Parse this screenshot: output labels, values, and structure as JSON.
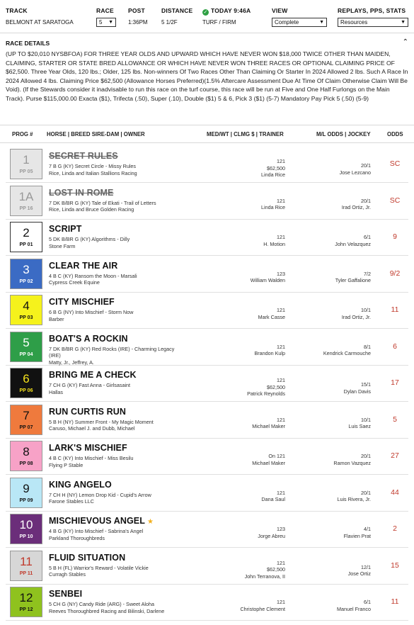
{
  "header": {
    "track_label": "TRACK",
    "track_value": "BELMONT AT SARATOGA",
    "race_label": "RACE",
    "race_value": "5",
    "post_label": "POST",
    "post_value": "1:36PM",
    "distance_label": "DISTANCE",
    "distance_value": "5 1/2F",
    "today_label": "TODAY 9:46A",
    "surface_value": "TURF / FIRM",
    "view_label": "VIEW",
    "view_value": "Complete",
    "replays_label": "REPLAYS, PPS, STATS",
    "replays_value": "Resources"
  },
  "race_details": {
    "title": "RACE DETAILS",
    "text": "(UP TO $20,010 NYSBFOA) FOR THREE YEAR OLDS AND UPWARD WHICH HAVE NEVER WON $18,000 TWICE OTHER THAN MAIDEN, CLAIMING, STARTER OR STATE BRED ALLOWANCE OR WHICH HAVE NEVER WON THREE RACES OR OPTIONAL CLAIMING PRICE OF $62,500. Three Year Olds, 120 lbs.; Older, 125 lbs. Non-winners Of Two Races Other Than Claiming Or Starter In 2024 Allowed 2 lbs. Such A Race In 2024 Allowed 4 lbs. Claiming Price $62,500 (Allowance Horses Preferred)(1.5% Aftercare Assessment Due At Time Of Claim Otherwise Claim Will Be Void). (If the Stewards consider it inadvisable to run this race on the turf course, this race will be run at Five and One Half Furlongs on the Main Track). Purse $115,000.00 Exacta ($1), Trifecta (.50), Super (.10), Double ($1) 5 & 6, Pick 3 ($1) (5-7) Mandatory Pay Pick 5 (.50) (5-9)"
  },
  "columns": {
    "prog": "PROG #",
    "horse": "HORSE | BREED SIRE-DAM | OWNER",
    "med": "MED/WT | CLMG $ | TRAINER",
    "ml": "M/L ODDS | JOCKEY",
    "odds": "ODDS"
  },
  "colors": {
    "scratch_bg": "#e6e6e6",
    "odds_red": "#c0392b"
  },
  "entries": [
    {
      "num": "1",
      "pp": "PP 05",
      "name": "SECRET RULES",
      "breed": "7 B G (KY) Secret Circle - Missy Rules",
      "owner": "Rice, Linda and Italian Stallions Racing",
      "med": "121",
      "clmg": "$62,500",
      "trainer": "Linda Rice",
      "ml": "20/1",
      "jockey": "Jose Lezcano",
      "odds": "SC",
      "bg": "#e6e6e6",
      "fg": "#999999",
      "scratched": true
    },
    {
      "num": "1A",
      "pp": "PP 16",
      "name": "LOST IN ROME",
      "breed": "7 DK B/BR G (KY) Tale of Ekati - Trail of Letters",
      "owner": "Rice, Linda and Bruce Golden Racing",
      "med": "121",
      "clmg": "",
      "trainer": "Linda Rice",
      "ml": "20/1",
      "jockey": "Irad Ortiz, Jr.",
      "odds": "SC",
      "bg": "#e6e6e6",
      "fg": "#999999",
      "scratched": true
    },
    {
      "num": "2",
      "pp": "PP 01",
      "name": "SCRIPT",
      "breed": "5 DK B/BR G (KY) Algorithms - Dilly",
      "owner": "Stone Farm",
      "med": "121",
      "clmg": "",
      "trainer": "H. Motion",
      "ml": "6/1",
      "jockey": "John Velazquez",
      "odds": "9",
      "bg": "#ffffff",
      "fg": "#111111",
      "scratched": false
    },
    {
      "num": "3",
      "pp": "PP 02",
      "name": "CLEAR THE AIR",
      "breed": "4 B C (KY) Ransom the Moon - Marsali",
      "owner": "Cypress Creek Equine",
      "med": "123",
      "clmg": "",
      "trainer": "William Walden",
      "ml": "7/2",
      "jockey": "Tyler Gaffalione",
      "odds": "9/2",
      "bg": "#3b6bc4",
      "fg": "#ffffff",
      "scratched": false
    },
    {
      "num": "4",
      "pp": "PP 03",
      "name": "CITY MISCHIEF",
      "breed": "6 B G (NY) Into Mischief - Storm Now",
      "owner": "Barber",
      "med": "121",
      "clmg": "",
      "trainer": "Mark Casse",
      "ml": "10/1",
      "jockey": "Irad Ortiz, Jr.",
      "odds": "11",
      "bg": "#f5f21c",
      "fg": "#111111",
      "scratched": false
    },
    {
      "num": "5",
      "pp": "PP 04",
      "name": "BOAT'S A ROCKIN",
      "breed": "7 DK B/BR G (KY) Red Rocks (IRE) - Charming Legacy (IRE)",
      "owner": "Matty, Jr., Jeffrey, A.",
      "med": "121",
      "clmg": "",
      "trainer": "Brandon Kulp",
      "ml": "8/1",
      "jockey": "Kendrick Carmouche",
      "odds": "6",
      "bg": "#2e9e48",
      "fg": "#ffffff",
      "scratched": false
    },
    {
      "num": "6",
      "pp": "PP 06",
      "name": "BRING ME A CHECK",
      "breed": "7 CH G (KY) Fast Anna - Girlsasaint",
      "owner": "Hallas",
      "med": "121",
      "clmg": "$62,500",
      "trainer": "Patrick Reynolds",
      "ml": "15/1",
      "jockey": "Dylan Davis",
      "odds": "17",
      "bg": "#111111",
      "fg": "#f5e21c",
      "scratched": false
    },
    {
      "num": "7",
      "pp": "PP 07",
      "name": "RUN CURTIS RUN",
      "breed": "5 B H (NY) Summer Front - My Magic Moment",
      "owner": "Caruso, Michael J. and Dubb, Michael",
      "med": "121",
      "clmg": "",
      "trainer": "Michael Maker",
      "ml": "10/1",
      "jockey": "Luis Saez",
      "odds": "5",
      "bg": "#ef7a3d",
      "fg": "#111111",
      "scratched": false
    },
    {
      "num": "8",
      "pp": "PP 08",
      "name": "LARK'S MISCHIEF",
      "breed": "4 B C (KY) Into Mischief - Miss Besilu",
      "owner": "Flying P Stable",
      "med": "On 121",
      "clmg": "",
      "trainer": "Michael Maker",
      "ml": "20/1",
      "jockey": "Ramon Vazquez",
      "odds": "27",
      "bg": "#f7a2c7",
      "fg": "#111111",
      "scratched": false
    },
    {
      "num": "9",
      "pp": "PP 09",
      "name": "KING ANGELO",
      "breed": "7 CH H (NY) Lemon Drop Kid - Cupid's Arrow",
      "owner": "Farone Stables LLC",
      "med": "121",
      "clmg": "",
      "trainer": "Dana Saul",
      "ml": "20/1",
      "jockey": "Luis Rivera, Jr.",
      "odds": "44",
      "bg": "#b9e7f6",
      "fg": "#111111",
      "scratched": false
    },
    {
      "num": "10",
      "pp": "PP 10",
      "name": "MISCHIEVOUS ANGEL",
      "breed": "4 B G (KY) Into Mischief - Sabrina's Angel",
      "owner": "Parkland Thoroughbreds",
      "med": "123",
      "clmg": "",
      "trainer": "Jorge Abreu",
      "ml": "4/1",
      "jockey": "Flavien Prat",
      "odds": "2",
      "bg": "#6b2e7a",
      "fg": "#ffffff",
      "scratched": false,
      "star": "★"
    },
    {
      "num": "11",
      "pp": "PP 11",
      "name": "FLUID SITUATION",
      "breed": "5 B H (FL) Warrior's Reward - Volatile Vickie",
      "owner": "Curragh Stables",
      "med": "121",
      "clmg": "$62,500",
      "trainer": "John Terranova, II",
      "ml": "12/1",
      "jockey": "Jose Ortiz",
      "odds": "15",
      "bg": "#d7d7d7",
      "fg": "#c0392b",
      "scratched": false
    },
    {
      "num": "12",
      "pp": "PP 12",
      "name": "SENBEI",
      "breed": "5 CH G (NY) Candy Ride (ARG) - Sweet Aloha",
      "owner": "Reeves Thoroughbred Racing and Bilinski, Darlene",
      "med": "121",
      "clmg": "",
      "trainer": "Christophe Clement",
      "ml": "6/1",
      "jockey": "Manuel Franco",
      "odds": "11",
      "bg": "#8fc21e",
      "fg": "#111111",
      "scratched": false
    }
  ]
}
